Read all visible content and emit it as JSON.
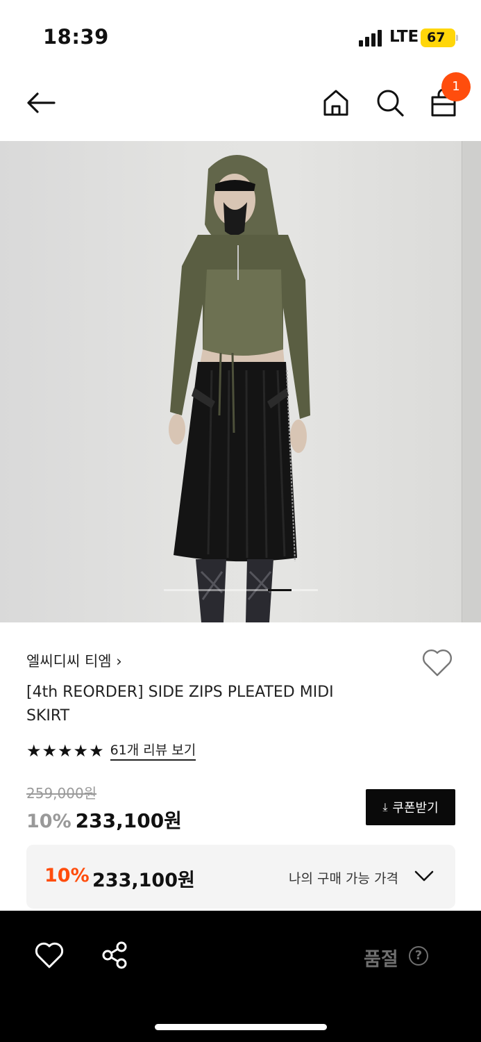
{
  "status_bar": {
    "time": "18:39",
    "network": "LTE",
    "battery": "67"
  },
  "nav": {
    "cart_count": "1"
  },
  "hero": {
    "image_alt": "",
    "indicator_position": 0.85
  },
  "product": {
    "brand": "엘씨디씨 티엠 ›",
    "title": "[4th REORDER] SIDE ZIPS PLEATED MIDI SKIRT",
    "stars": "★★★★★",
    "rating": 5,
    "review_link": "61개 리뷰 보기",
    "original_price": "259,000원",
    "discount": "10%",
    "price": "233,100원",
    "coupon_label": "쿠폰받기",
    "best_price": {
      "discount": "10%",
      "price": "233,100원",
      "label": "나의 구매 가능 가격"
    }
  },
  "bottom_bar": {
    "soldout_label": "품절",
    "help_glyph": "?"
  },
  "colors": {
    "accent": "#ff4d0d",
    "dark": "#000000",
    "battery": "#ffd60a"
  }
}
